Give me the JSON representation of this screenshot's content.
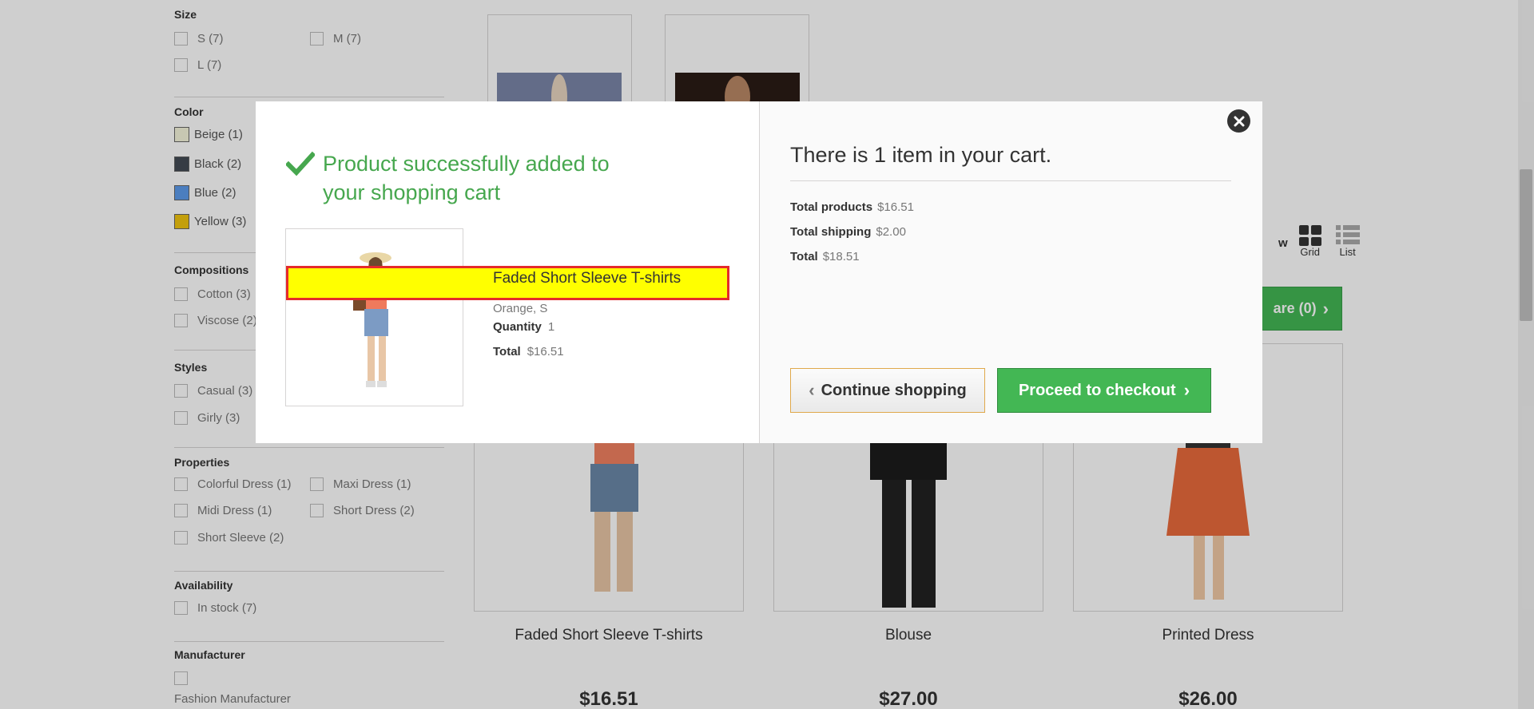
{
  "sidebar": {
    "size": {
      "title": "Size",
      "options": [
        "S (7)",
        "M (7)",
        "L (7)"
      ]
    },
    "color": {
      "title": "Color",
      "options": [
        {
          "label": "Beige (1)",
          "swatch": "#f5f5dc"
        },
        {
          "label": "Black (2)",
          "swatch": "#434a54"
        },
        {
          "label": "Blue (2)",
          "swatch": "#5d9cec"
        },
        {
          "label": "Yellow (3)",
          "swatch": "#f1c40f"
        }
      ]
    },
    "compositions": {
      "title": "Compositions",
      "options": [
        "Cotton (3)",
        "Viscose (2)"
      ]
    },
    "styles": {
      "title": "Styles",
      "options": [
        "Casual (3)",
        "Girly (3)"
      ]
    },
    "properties": {
      "title": "Properties",
      "options": [
        "Colorful Dress (1)",
        "Maxi Dress (1)",
        "Midi Dress (1)",
        "Short Dress (2)",
        "Short Sleeve (2)"
      ]
    },
    "availability": {
      "title": "Availability",
      "options": [
        "In stock (7)"
      ]
    },
    "manufacturer": {
      "title": "Manufacturer",
      "options": [
        "Fashion Manufacturer"
      ]
    }
  },
  "listing": {
    "view_label_fragment": "w",
    "grid_label": "Grid",
    "list_label": "List",
    "compare_label": "are (0)",
    "products": [
      {
        "name": "Faded Short Sleeve T-shirts",
        "price": "$16.51"
      },
      {
        "name": "Blouse",
        "price": "$27.00"
      },
      {
        "name": "Printed Dress",
        "price": "$26.00"
      }
    ]
  },
  "modal": {
    "success_title": "Product successfully added to your shopping cart",
    "product": {
      "name": "Faded Short Sleeve T-shirts",
      "attributes": "Orange, S",
      "quantity_label": "Quantity",
      "quantity": "1",
      "total_label": "Total",
      "total": "$16.51"
    },
    "cart": {
      "title": "There is 1 item in your cart.",
      "total_products_label": "Total products",
      "total_products": "$16.51",
      "total_shipping_label": "Total shipping",
      "total_shipping": "$2.00",
      "total_label": "Total",
      "total": "$18.51"
    },
    "continue_label": "Continue shopping",
    "checkout_label": "Proceed to checkout",
    "colors": {
      "success": "#46a74e",
      "button_green": "#43b754",
      "highlight": "#ffff00",
      "highlight_border": "#e52b2b"
    }
  }
}
